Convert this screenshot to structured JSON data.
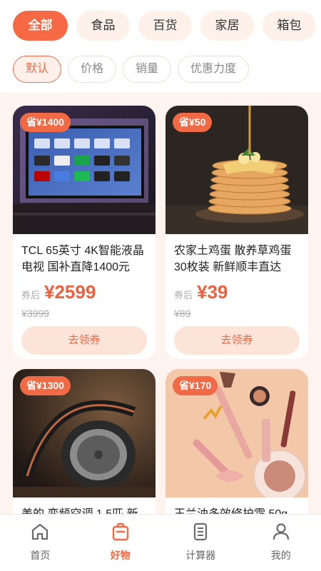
{
  "colors": {
    "accent": "#f56a45",
    "accent_light": "#fde4d8",
    "page_bg": "#fff3ef"
  },
  "categories": [
    {
      "label": "全部",
      "active": true
    },
    {
      "label": "食品",
      "active": false
    },
    {
      "label": "百货",
      "active": false
    },
    {
      "label": "家居",
      "active": false
    },
    {
      "label": "箱包",
      "active": false
    }
  ],
  "sort": [
    {
      "label": "默认",
      "active": true
    },
    {
      "label": "价格",
      "active": false
    },
    {
      "label": "销量",
      "active": false
    },
    {
      "label": "优惠力度",
      "active": false
    }
  ],
  "products": [
    {
      "badge": "省¥1400",
      "title": "TCL 65英寸 4K智能液晶电视 国补直降1400元",
      "coupon_label": "券后",
      "price": "¥2599",
      "original_price": "¥3999",
      "button": "去领券",
      "image": "smart-tv"
    },
    {
      "badge": "省¥50",
      "title": "农家土鸡蛋 散养草鸡蛋30枚装 新鲜顺丰直达",
      "coupon_label": "券后",
      "price": "¥39",
      "original_price": "¥89",
      "button": "去领券",
      "image": "pancakes"
    },
    {
      "badge": "省¥1300",
      "title": "美的 变频空调 1.5匹 新",
      "image": "headphones"
    },
    {
      "badge": "省¥170",
      "title": "玉兰油多效修护霜 50g",
      "image": "cosmetics"
    }
  ],
  "tabbar": [
    {
      "label": "首页",
      "icon": "home-icon",
      "active": false
    },
    {
      "label": "好物",
      "icon": "bag-icon",
      "active": true
    },
    {
      "label": "计算器",
      "icon": "calculator-icon",
      "active": false
    },
    {
      "label": "我的",
      "icon": "user-icon",
      "active": false
    }
  ]
}
